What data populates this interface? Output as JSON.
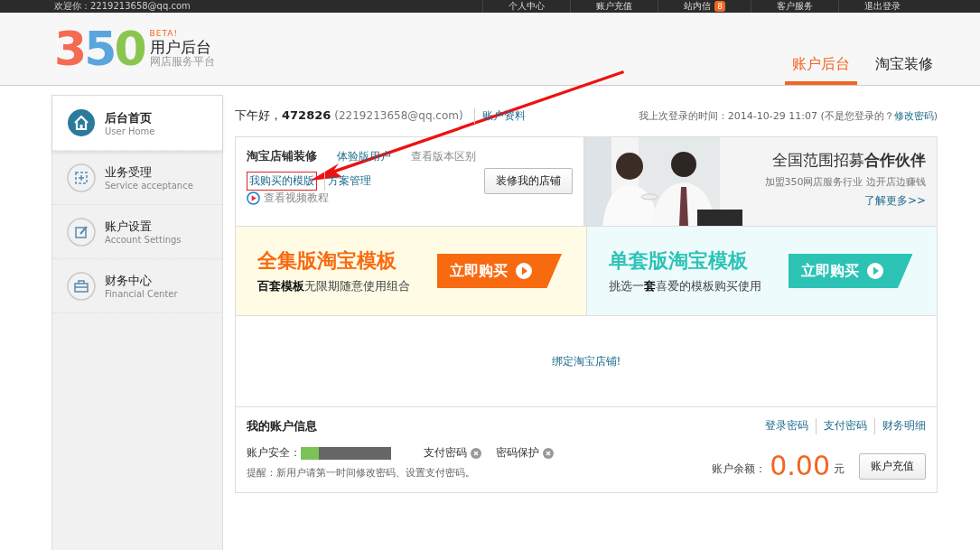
{
  "top_bar": {
    "welcome": "欢迎你：2219213658@qq.com",
    "links": [
      {
        "label": "个人中心"
      },
      {
        "label": "账户充值"
      },
      {
        "label": "站内信",
        "badge": "8"
      },
      {
        "label": "客户服务"
      },
      {
        "label": "退出登录"
      }
    ]
  },
  "header": {
    "logo": "350",
    "beta": "BETA!",
    "title": "用户后台",
    "subtitle": "网店服务平台",
    "tabs": [
      {
        "label": "账户后台",
        "selected": true
      },
      {
        "label": "淘宝装修",
        "selected": false
      }
    ]
  },
  "sidebar": {
    "items": [
      {
        "title": "后台首页",
        "subtitle": "User Home",
        "selected": true
      },
      {
        "title": "业务受理",
        "subtitle": "Service acceptance",
        "selected": false
      },
      {
        "title": "账户设置",
        "subtitle": "Account Settings",
        "selected": false
      },
      {
        "title": "财务中心",
        "subtitle": "Financial Center",
        "selected": false
      }
    ]
  },
  "greeting": {
    "text": "下午好，",
    "user": "472826",
    "email": "(2219213658@qq.com)",
    "link": "账户资料",
    "last_login": "我上次登录的时间：2014-10-29 11:07 (不是您登录的？",
    "last_login_link": "修改密码",
    "close": ")"
  },
  "shop_panel": {
    "title": "淘宝店铺装修",
    "user_type": "体验版用户",
    "compare_link": "查看版本区别",
    "links": [
      {
        "label": "我购买的模版",
        "highlighted": true
      },
      {
        "label": "方案管理",
        "highlighted": false
      }
    ],
    "video_link": "查看视频教程",
    "button": "装修我的店铺"
  },
  "banner": {
    "kind": "picture",
    "title": "全国范围招募",
    "title_bold": "合作伙伴",
    "subtitle": "加盟350网店服务行业  边开店边赚钱",
    "link": "了解更多>>"
  },
  "promos": [
    {
      "kind": "full",
      "title": "全集版淘宝模板",
      "desc": "**百套模板**无限期随意使用组合",
      "button": "立即购买"
    },
    {
      "kind": "single",
      "title": "单套版淘宝模板",
      "desc": "挑选一**套**喜爱的模板购买使用",
      "button": "立即购买"
    }
  ],
  "bind_link": "绑定淘宝店铺!",
  "account": {
    "title": "我的账户信息",
    "links": [
      "登录密码",
      "支付密码",
      "财务明细"
    ],
    "security_label": "账户安全：",
    "security": {
      "level": 0.2
    },
    "checks": [
      {
        "label": "支付密码",
        "done": false
      },
      {
        "label": "密码保护",
        "done": false
      }
    ],
    "reminder": "提醒：新用户请第一时间修改密码、设置支付密码。",
    "balance_label": "账户余额：",
    "balance": "0.00",
    "currency": "元",
    "recharge": "账户充值"
  },
  "annotation": {
    "arrow": true
  }
}
